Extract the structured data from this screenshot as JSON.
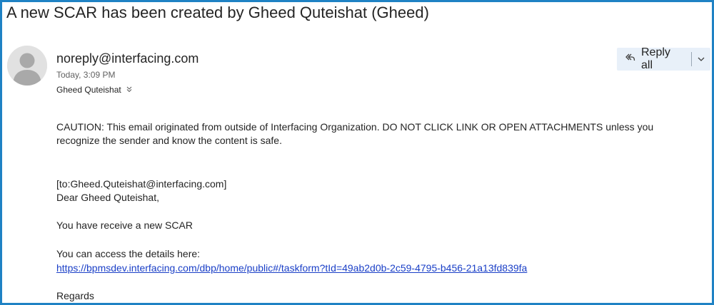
{
  "email": {
    "subject": "A new SCAR has been created by Gheed Quteishat (Gheed)",
    "sender": "noreply@interfacing.com",
    "time": "Today, 3:09 PM",
    "recipient": "Gheed Quteishat",
    "reply_all_label": "Reply all",
    "caution": "CAUTION: This email originated from outside of Interfacing Organization. DO NOT CLICK LINK OR OPEN ATTACHMENTS unless you recognize the sender and know the content is safe.",
    "to_line": "[to:Gheed.Quteishat@interfacing.com]",
    "greeting": "Dear Gheed Quteishat,",
    "line1": "You have receive a new SCAR",
    "line2": "You can access the details here:",
    "link": "https://bpmsdev.interfacing.com/dbp/home/public#/taskform?tId=49ab2d0b-2c59-4795-b456-21a13fd839fa",
    "closing": "Regards"
  },
  "colors": {
    "frame_border": "#1f82c4",
    "link": "#1a3fc7",
    "reply_bg": "#e8f0f9"
  },
  "icons": {
    "avatar": "person-avatar-icon",
    "recipient_expand": "chevron-double-down-icon",
    "reply_all": "reply-all-icon",
    "reply_more": "chevron-down-icon"
  }
}
